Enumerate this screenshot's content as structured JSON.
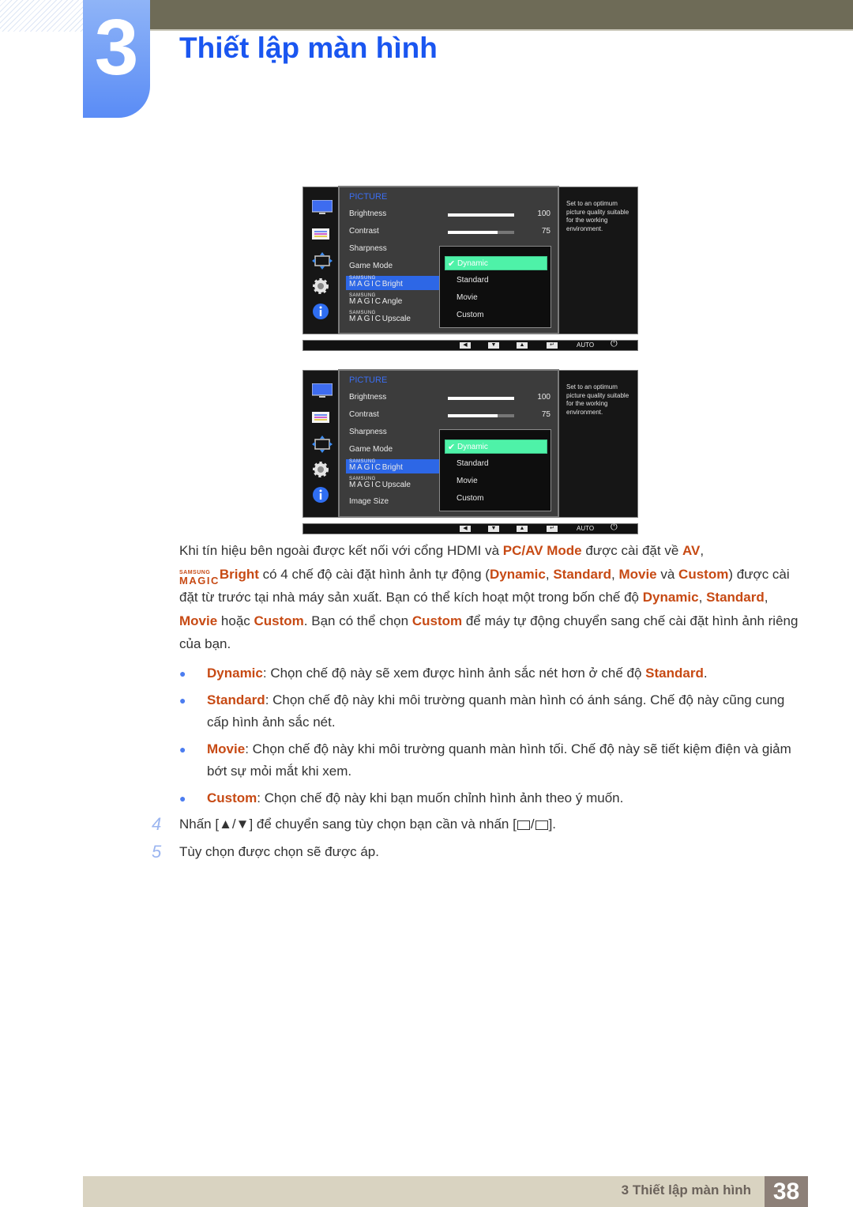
{
  "header": {
    "chapter_number": "3",
    "title": "Thiết lập màn hình"
  },
  "osd_screens": [
    {
      "section": "PICTURE",
      "sidebar_icons": [
        "monitor-icon",
        "picture-settings-icon",
        "resize-icon",
        "gear-icon",
        "info-icon"
      ],
      "menu_items": [
        "Brightness",
        "Contrast",
        "Sharpness",
        "Game Mode",
        {
          "magic_top": "SAMSUNG",
          "magic_bottom": "MAGIC",
          "suffix": "Bright",
          "selected": true
        },
        {
          "magic_top": "SAMSUNG",
          "magic_bottom": "MAGIC",
          "suffix": "Angle"
        },
        {
          "magic_top": "SAMSUNG",
          "magic_bottom": "MAGIC",
          "suffix": "Upscale"
        }
      ],
      "brightness": {
        "value": "100",
        "fraction": 1.0
      },
      "contrast": {
        "value": "75",
        "fraction": 0.75
      },
      "dropdown": {
        "options": [
          "Dynamic",
          "Standard",
          "Movie",
          "Custom"
        ],
        "selected": "Dynamic"
      },
      "help_text": "Set to an optimum picture quality suitable for the working environment.",
      "footer": {
        "buttons": [
          "left-arrow",
          "down-arrow",
          "up-arrow",
          "enter"
        ],
        "auto": "AUTO",
        "power": "power-icon"
      }
    },
    {
      "section": "PICTURE",
      "sidebar_icons": [
        "monitor-icon",
        "picture-settings-icon",
        "resize-icon",
        "gear-icon",
        "info-icon"
      ],
      "menu_items": [
        "Brightness",
        "Contrast",
        "Sharpness",
        "Game Mode",
        {
          "magic_top": "SAMSUNG",
          "magic_bottom": "MAGIC",
          "suffix": "Bright",
          "selected": true
        },
        {
          "magic_top": "SAMSUNG",
          "magic_bottom": "MAGIC",
          "suffix": "Upscale"
        },
        "Image Size"
      ],
      "brightness": {
        "value": "100",
        "fraction": 1.0
      },
      "contrast": {
        "value": "75",
        "fraction": 0.75
      },
      "dropdown": {
        "options": [
          "Dynamic",
          "Standard",
          "Movie",
          "Custom"
        ],
        "selected": "Dynamic"
      },
      "help_text": "Set to an optimum picture quality suitable for the working environment.",
      "footer": {
        "buttons": [
          "left-arrow",
          "down-arrow",
          "up-arrow",
          "enter"
        ],
        "auto": "AUTO",
        "power": "power-icon"
      }
    }
  ],
  "intro": {
    "t1": "Khi tín hiệu bên ngoài được kết nối với cổng HDMI và ",
    "h1": "PC/AV Mode",
    "t2": " được cài đặt về ",
    "h2": "AV",
    "t3": ",",
    "magic_top": "SAMSUNG",
    "magic_bottom": "MAGIC",
    "magic_suffix": "Bright",
    "t4": " có 4 chế độ cài đặt hình ảnh tự động (",
    "h3": "Dynamic",
    "t5": ", ",
    "h4": "Standard",
    "t6": ", ",
    "h5": "Movie",
    "t7": " và ",
    "h6": "Custom",
    "t8": ") được cài đặt từ trước tại nhà máy sản xuất. Bạn có thể kích hoạt một trong bốn chế độ ",
    "h7": "Dynamic",
    "t9": ", ",
    "h8": "Standard",
    "t10": ", ",
    "h9": "Movie",
    "t11": " hoặc ",
    "h10": "Custom",
    "t12": ". Bạn có thể chọn ",
    "h11": "Custom",
    "t13": " để máy tự động chuyển sang chế cài đặt hình ảnh riêng của bạn."
  },
  "bullets": [
    {
      "term": "Dynamic",
      "text": ": Chọn chế độ này sẽ xem được hình ảnh sắc nét hơn ở chế độ ",
      "term2": "Standard",
      "end": "."
    },
    {
      "term": "Standard",
      "text": ": Chọn chế độ này khi môi trường quanh màn hình có ánh sáng. Chế độ này cũng cung cấp hình ảnh sắc nét."
    },
    {
      "term": "Movie",
      "text": ": Chọn chế độ này khi môi trường quanh màn hình tối. Chế độ này sẽ tiết kiệm điện và giảm bớt sự mỏi mắt khi xem."
    },
    {
      "term": "Custom",
      "text": ": Chọn chế độ này khi bạn muốn chỉnh hình ảnh theo ý muốn."
    }
  ],
  "steps": [
    {
      "number": "4",
      "before": "Nhấn [",
      "keys": "▲/▼",
      "middle": "] để chuyển sang tùy chọn bạn cần và nhấn [",
      "after": "]."
    },
    {
      "number": "5",
      "text": "Tùy chọn được chọn sẽ được áp."
    }
  ],
  "footer": {
    "section_label": "3 Thiết lập màn hình",
    "page_number": "38"
  }
}
